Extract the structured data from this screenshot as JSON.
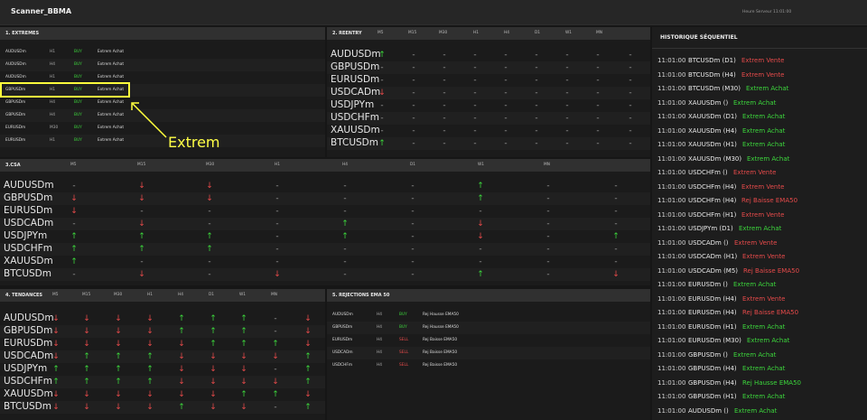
{
  "app": {
    "title": "Scanner_BBMA",
    "server_time": "Heure Serveur 11:01:00"
  },
  "extremes": {
    "title": "1. EXTREMES",
    "rows": [
      {
        "symbol": "AUDUSDm",
        "tf": "H1",
        "dir": "BUY",
        "msg": "Extrem Achat"
      },
      {
        "symbol": "AUDUSDm",
        "tf": "H4",
        "dir": "BUY",
        "msg": "Extrem Achat"
      },
      {
        "symbol": "AUDUSDm",
        "tf": "H1",
        "dir": "BUY",
        "msg": "Extrem Achat"
      },
      {
        "symbol": "GBPUSDm",
        "tf": "H1",
        "dir": "BUY",
        "msg": "Extrem Achat"
      },
      {
        "symbol": "GBPUSDm",
        "tf": "H4",
        "dir": "BUY",
        "msg": "Extrem Achat"
      },
      {
        "symbol": "GBPUSDm",
        "tf": "H4",
        "dir": "BUY",
        "msg": "Extrem Achat"
      },
      {
        "symbol": "EURUSDm",
        "tf": "M30",
        "dir": "BUY",
        "msg": "Extrem Achat"
      },
      {
        "symbol": "EURUSDm",
        "tf": "H1",
        "dir": "BUY",
        "msg": "Extrem Achat"
      }
    ]
  },
  "annotation": {
    "label": "Extrem"
  },
  "reentry": {
    "title": "2. REENTRY",
    "cols": [
      "M5",
      "M15",
      "M30",
      "H1",
      "H4",
      "D1",
      "W1",
      "MN"
    ],
    "rows": [
      {
        "symbol": "AUDUSDm",
        "cells": [
          "↑",
          "-",
          "-",
          "-",
          "-",
          "-",
          "-",
          "-",
          "-"
        ]
      },
      {
        "symbol": "GBPUSDm",
        "cells": [
          "-",
          "-",
          "-",
          "-",
          "-",
          "-",
          "-",
          "-",
          "-"
        ]
      },
      {
        "symbol": "EURUSDm",
        "cells": [
          "-",
          "-",
          "-",
          "-",
          "-",
          "-",
          "-",
          "-",
          "-"
        ]
      },
      {
        "symbol": "USDCADm",
        "cells": [
          "↓",
          "-",
          "-",
          "-",
          "-",
          "-",
          "-",
          "-",
          "-"
        ]
      },
      {
        "symbol": "USDJPYm",
        "cells": [
          "-",
          "-",
          "-",
          "-",
          "-",
          "-",
          "-",
          "-",
          "-"
        ]
      },
      {
        "symbol": "USDCHFm",
        "cells": [
          "-",
          "-",
          "-",
          "-",
          "-",
          "-",
          "-",
          "-",
          "-"
        ]
      },
      {
        "symbol": "XAUUSDm",
        "cells": [
          "-",
          "-",
          "-",
          "-",
          "-",
          "-",
          "-",
          "-",
          "-"
        ]
      },
      {
        "symbol": "BTCUSDm",
        "cells": [
          "↑",
          "-",
          "-",
          "-",
          "-",
          "-",
          "-",
          "-",
          "-"
        ]
      }
    ]
  },
  "csa": {
    "title": "3.CSA",
    "cols": [
      "M5",
      "M15",
      "M30",
      "H1",
      "H4",
      "D1",
      "W1",
      "MN"
    ],
    "rows": [
      {
        "symbol": "AUDUSDm",
        "cells": [
          "-",
          "↓",
          "↓",
          "-",
          "-",
          "-",
          "↑",
          "-",
          "-"
        ]
      },
      {
        "symbol": "GBPUSDm",
        "cells": [
          "↓",
          "↓",
          "↓",
          "-",
          "-",
          "-",
          "↑",
          "-",
          "-"
        ]
      },
      {
        "symbol": "EURUSDm",
        "cells": [
          "↓",
          "-",
          "-",
          "-",
          "-",
          "-",
          "-",
          "-",
          "-"
        ]
      },
      {
        "symbol": "USDCADm",
        "cells": [
          "-",
          "↓",
          "-",
          "-",
          "↑",
          "-",
          "↓",
          "-",
          "-"
        ]
      },
      {
        "symbol": "USDJPYm",
        "cells": [
          "↑",
          "↑",
          "↑",
          "-",
          "↑",
          "-",
          "↓",
          "-",
          "↑"
        ]
      },
      {
        "symbol": "USDCHFm",
        "cells": [
          "↑",
          "↑",
          "↑",
          "-",
          "-",
          "-",
          "-",
          "-",
          "-"
        ]
      },
      {
        "symbol": "XAUUSDm",
        "cells": [
          "↑",
          "-",
          "-",
          "-",
          "-",
          "-",
          "-",
          "-",
          "-"
        ]
      },
      {
        "symbol": "BTCUSDm",
        "cells": [
          "-",
          "↓",
          "-",
          "↓",
          "-",
          "-",
          "↑",
          "-",
          "↓"
        ]
      }
    ]
  },
  "tendances": {
    "title": "4. TENDANCES",
    "cols": [
      "M5",
      "M15",
      "M30",
      "H1",
      "H4",
      "D1",
      "W1",
      "MN"
    ],
    "rows": [
      {
        "symbol": "AUDUSDm",
        "cells": [
          "↓",
          "↓",
          "↓",
          "↓",
          "↑",
          "↑",
          "↑",
          "-",
          "↓"
        ]
      },
      {
        "symbol": "GBPUSDm",
        "cells": [
          "↓",
          "↓",
          "↓",
          "↓",
          "↑",
          "↑",
          "↑",
          "-",
          "↓"
        ]
      },
      {
        "symbol": "EURUSDm",
        "cells": [
          "↓",
          "↓",
          "↓",
          "↓",
          "↓",
          "↑",
          "↑",
          "↑",
          "↓"
        ]
      },
      {
        "symbol": "USDCADm",
        "cells": [
          "↓",
          "↑",
          "↑",
          "↑",
          "↓",
          "↓",
          "↓",
          "↓",
          "↑"
        ]
      },
      {
        "symbol": "USDJPYm",
        "cells": [
          "↑",
          "↑",
          "↑",
          "↑",
          "↓",
          "↓",
          "↓",
          "-",
          "↑"
        ]
      },
      {
        "symbol": "USDCHFm",
        "cells": [
          "↑",
          "↑",
          "↑",
          "↑",
          "↓",
          "↓",
          "↓",
          "↓",
          "↑"
        ]
      },
      {
        "symbol": "XAUUSDm",
        "cells": [
          "↓",
          "↓",
          "↓",
          "↓",
          "↓",
          "↓",
          "↑",
          "↑",
          "↓"
        ]
      },
      {
        "symbol": "BTCUSDm",
        "cells": [
          "↓",
          "↓",
          "↓",
          "↓",
          "↑",
          "↓",
          "↓",
          "-",
          "↑"
        ]
      }
    ]
  },
  "rejections": {
    "title": "5. REJECTIONS EMA 50",
    "rows": [
      {
        "symbol": "AUDUSDm",
        "tf": "H4",
        "dir": "BUY",
        "msg": "Rej Hausse EMA50"
      },
      {
        "symbol": "GBPUSDm",
        "tf": "H4",
        "dir": "BUY",
        "msg": "Rej Hausse EMA50"
      },
      {
        "symbol": "EURUSDm",
        "tf": "H4",
        "dir": "SELL",
        "msg": "Rej Baisse EMA50"
      },
      {
        "symbol": "USDCADm",
        "tf": "H4",
        "dir": "SELL",
        "msg": "Rej Baisse EMA50"
      },
      {
        "symbol": "USDCHFm",
        "tf": "H4",
        "dir": "SELL",
        "msg": "Rej Baisse EMA50"
      }
    ]
  },
  "historique": {
    "title": "HISTORIQUE SÉQUENTIEL",
    "items": [
      {
        "time": "11:01:00",
        "pair": "BTCUSDm (D1)",
        "msg": "Extrem Vente",
        "kind": "sell"
      },
      {
        "time": "11:01:00",
        "pair": "BTCUSDm (H4)",
        "msg": "Extrem Vente",
        "kind": "sell"
      },
      {
        "time": "11:01:00",
        "pair": "BTCUSDm (M30)",
        "msg": "Extrem Achat",
        "kind": "buy"
      },
      {
        "time": "11:01:00",
        "pair": "XAUUSDm ()",
        "msg": "Extrem Achat",
        "kind": "buy"
      },
      {
        "time": "11:01:00",
        "pair": "XAUUSDm (D1)",
        "msg": "Extrem Achat",
        "kind": "buy"
      },
      {
        "time": "11:01:00",
        "pair": "XAUUSDm (H4)",
        "msg": "Extrem Achat",
        "kind": "buy"
      },
      {
        "time": "11:01:00",
        "pair": "XAUUSDm (H1)",
        "msg": "Extrem Achat",
        "kind": "buy"
      },
      {
        "time": "11:01:00",
        "pair": "XAUUSDm (M30)",
        "msg": "Extrem Achat",
        "kind": "buy"
      },
      {
        "time": "11:01:00",
        "pair": "USDCHFm ()",
        "msg": "Extrem Vente",
        "kind": "sell"
      },
      {
        "time": "11:01:00",
        "pair": "USDCHFm (H4)",
        "msg": "Extrem Vente",
        "kind": "sell"
      },
      {
        "time": "11:01:00",
        "pair": "USDCHFm (H4)",
        "msg": "Rej Baisse EMA50",
        "kind": "sell"
      },
      {
        "time": "11:01:00",
        "pair": "USDCHFm (H1)",
        "msg": "Extrem Vente",
        "kind": "sell"
      },
      {
        "time": "11:01:00",
        "pair": "USDJPYm (D1)",
        "msg": "Extrem Achat",
        "kind": "buy"
      },
      {
        "time": "11:01:00",
        "pair": "USDCADm ()",
        "msg": "Extrem Vente",
        "kind": "sell"
      },
      {
        "time": "11:01:00",
        "pair": "USDCADm (H1)",
        "msg": "Extrem Vente",
        "kind": "sell"
      },
      {
        "time": "11:01:00",
        "pair": "USDCADm (M5)",
        "msg": "Rej Baisse EMA50",
        "kind": "sell"
      },
      {
        "time": "11:01:00",
        "pair": "EURUSDm ()",
        "msg": "Extrem Achat",
        "kind": "buy"
      },
      {
        "time": "11:01:00",
        "pair": "EURUSDm (H4)",
        "msg": "Extrem Vente",
        "kind": "sell"
      },
      {
        "time": "11:01:00",
        "pair": "EURUSDm (H4)",
        "msg": "Rej Baisse EMA50",
        "kind": "sell"
      },
      {
        "time": "11:01:00",
        "pair": "EURUSDm (H1)",
        "msg": "Extrem Achat",
        "kind": "buy"
      },
      {
        "time": "11:01:00",
        "pair": "EURUSDm (M30)",
        "msg": "Extrem Achat",
        "kind": "buy"
      },
      {
        "time": "11:01:00",
        "pair": "GBPUSDm ()",
        "msg": "Extrem Achat",
        "kind": "buy"
      },
      {
        "time": "11:01:00",
        "pair": "GBPUSDm (H4)",
        "msg": "Extrem Achat",
        "kind": "buy"
      },
      {
        "time": "11:01:00",
        "pair": "GBPUSDm (H4)",
        "msg": "Rej Hausse EMA50",
        "kind": "buy"
      },
      {
        "time": "11:01:00",
        "pair": "GBPUSDm (H1)",
        "msg": "Extrem Achat",
        "kind": "buy"
      },
      {
        "time": "11:01:00",
        "pair": "AUDUSDm ()",
        "msg": "Extrem Achat",
        "kind": "buy"
      }
    ]
  },
  "colors": {
    "buy": "#3cd63c",
    "sell": "#e64a4a",
    "highlight": "#ffff3c"
  }
}
